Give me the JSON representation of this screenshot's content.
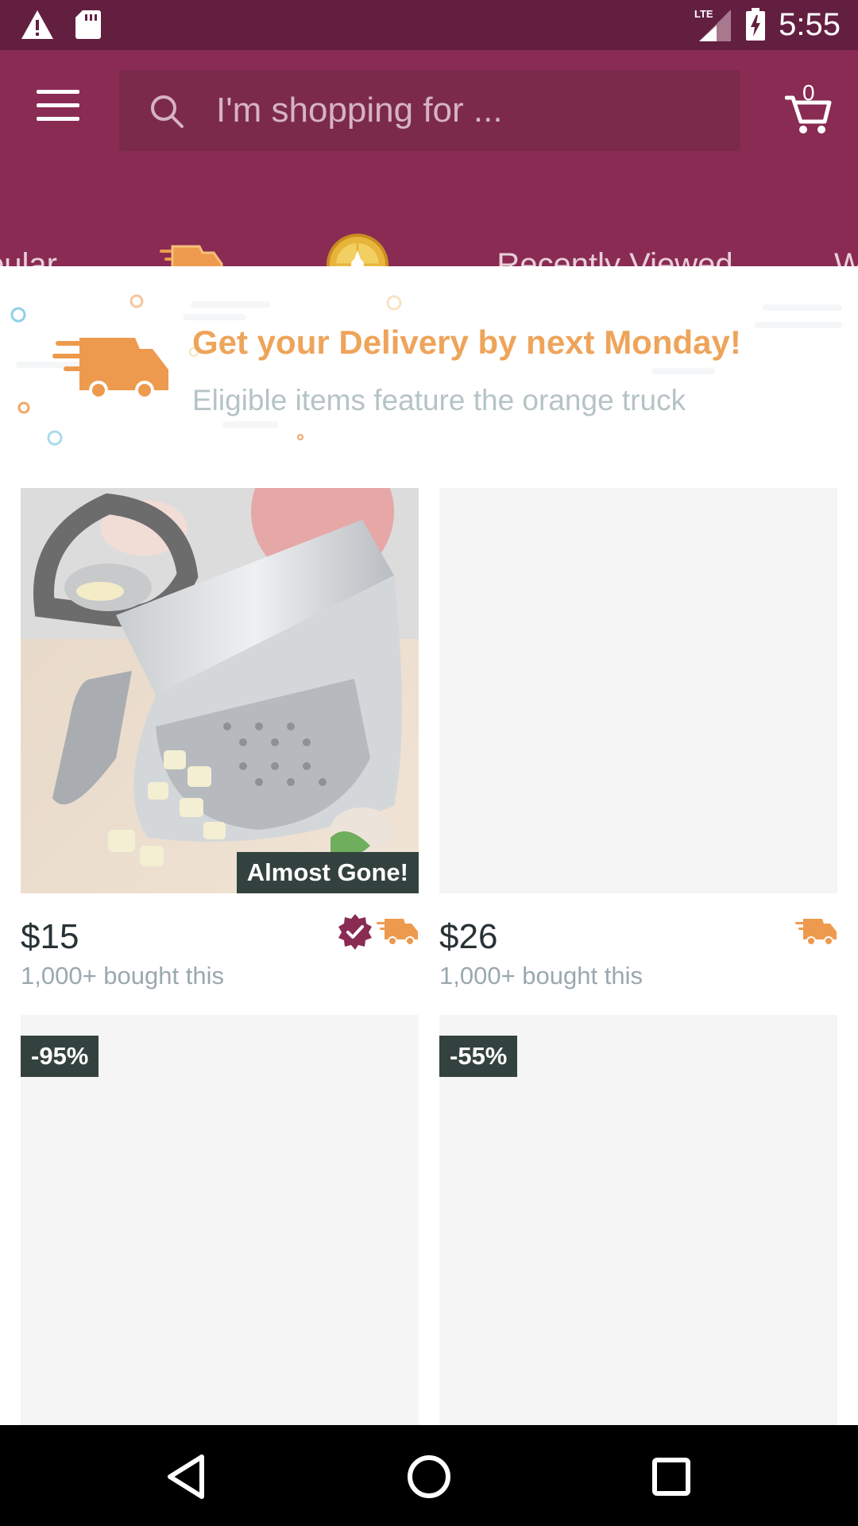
{
  "status_bar": {
    "time": "5:55",
    "network": "LTE",
    "icons": [
      "warning-icon",
      "sd-card-icon",
      "signal-icon",
      "battery-charging-icon"
    ]
  },
  "header": {
    "search_placeholder": "I'm shopping for ...",
    "cart_count": "0",
    "icons": [
      "menu-icon",
      "search-icon",
      "cart-icon"
    ]
  },
  "tabs": [
    {
      "label": "Popular",
      "icon": null,
      "selected": false
    },
    {
      "label": "",
      "icon": "delivery-truck-icon",
      "selected": true
    },
    {
      "label": "",
      "icon": "wheel-icon",
      "selected": false
    },
    {
      "label": "Recently Viewed",
      "icon": null,
      "selected": false
    },
    {
      "label": "W",
      "icon": null,
      "selected": false
    }
  ],
  "banner": {
    "title": "Get your Delivery by next Monday!",
    "subtitle": "Eligible items feature the orange truck",
    "icon": "delivery-truck-icon"
  },
  "products": [
    {
      "price": "$15",
      "bought": "1,000+ bought this",
      "badge": "Almost Gone!",
      "verified": true,
      "fast_delivery": true,
      "image": "garlic-press-image"
    },
    {
      "price": "$26",
      "bought": "1,000+ bought this",
      "badge": "",
      "verified": false,
      "fast_delivery": true,
      "image": ""
    },
    {
      "price": "",
      "bought": "",
      "badge": "-95%",
      "verified": false,
      "fast_delivery": false,
      "image": ""
    },
    {
      "price": "",
      "bought": "",
      "badge": "-55%",
      "verified": false,
      "fast_delivery": false,
      "image": ""
    }
  ],
  "colors": {
    "status_bar": "#631f40",
    "app_bar": "#8a2b54",
    "accent_orange": "#eea45a",
    "badge_dark": "#34423f",
    "verified": "#8a2b54"
  },
  "nav_bar": {
    "icons": [
      "back-icon",
      "home-icon",
      "recents-icon"
    ]
  }
}
